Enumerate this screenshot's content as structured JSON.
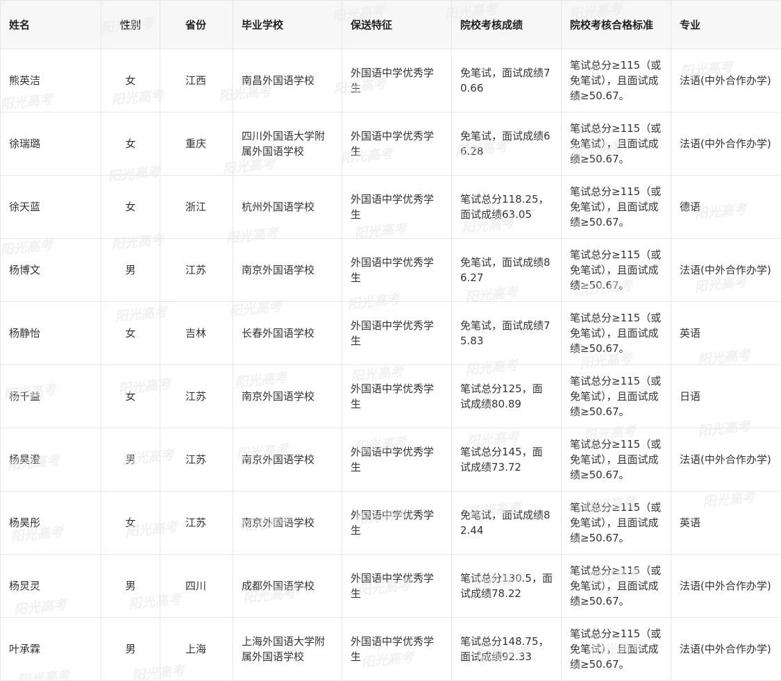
{
  "table": {
    "headers": [
      "姓名",
      "性别",
      "省份",
      "毕业学校",
      "保送特征",
      "院校考核成绩",
      "院校考核合格标准",
      "专业"
    ],
    "rows": [
      [
        "熊英洁",
        "女",
        "江西",
        "南昌外国语学校",
        "外国语中学优秀学生",
        "免笔试，面试成绩70.66",
        "笔试总分≥115（或免笔试），且面试成绩≥50.67。",
        "法语(中外合作办学)"
      ],
      [
        "徐瑞璐",
        "女",
        "重庆",
        "四川外国语大学附属外国语学校",
        "外国语中学优秀学生",
        "免笔试，面试成绩66.28",
        "笔试总分≥115（或免笔试），且面试成绩≥50.67。",
        "法语(中外合作办学)"
      ],
      [
        "徐天蓝",
        "女",
        "浙江",
        "杭州外国语学校",
        "外国语中学优秀学生",
        "笔试总分118.25，面试成绩63.05",
        "笔试总分≥115（或免笔试），且面试成绩≥50.67。",
        "德语"
      ],
      [
        "杨博文",
        "男",
        "江苏",
        "南京外国语学校",
        "外国语中学优秀学生",
        "免笔试，面试成绩86.27",
        "笔试总分≥115（或免笔试），且面试成绩≥50.67。",
        "法语(中外合作办学)"
      ],
      [
        "杨静怡",
        "女",
        "吉林",
        "长春外国语学校",
        "外国语中学优秀学生",
        "免笔试，面试成绩75.83",
        "笔试总分≥115（或免笔试），且面试成绩≥50.67。",
        "英语"
      ],
      [
        "杨千益",
        "女",
        "江苏",
        "南京外国语学校",
        "外国语中学优秀学生",
        "笔试总分125，面试成绩80.89",
        "笔试总分≥115（或免笔试），且面试成绩≥50.67。",
        "日语"
      ],
      [
        "杨昊澄",
        "男",
        "江苏",
        "南京外国语学校",
        "外国语中学优秀学生",
        "笔试总分145，面试成绩73.72",
        "笔试总分≥115（或免笔试），且面试成绩≥50.67。",
        "法语(中外合作办学)"
      ],
      [
        "杨昊彤",
        "女",
        "江苏",
        "南京外国语学校",
        "外国语中学优秀学生",
        "免笔试，面试成绩82.44",
        "笔试总分≥115（或免笔试），且面试成绩≥50.67。",
        "英语"
      ],
      [
        "杨炅灵",
        "男",
        "四川",
        "成都外国语学校",
        "外国语中学优秀学生",
        "笔试总分130.5，面试成绩78.22",
        "笔试总分≥115（或免笔试），且面试成绩≥50.67。",
        "法语(中外合作办学)"
      ],
      [
        "叶承霖",
        "男",
        "上海",
        "上海外国语大学附属外国语学校",
        "外国语中学优秀学生",
        "笔试总分148.75，面试成绩92.33",
        "笔试总分≥115（或免笔试），且面试成绩≥50.67。",
        "法语(中外合作办学)"
      ]
    ]
  },
  "watermark": {
    "text": "阳光高考",
    "color": "#e7e7e7"
  }
}
